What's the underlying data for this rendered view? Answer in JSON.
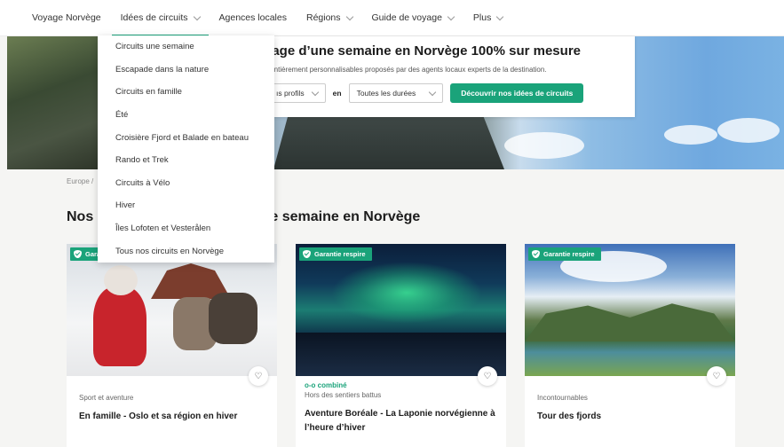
{
  "nav": {
    "items": [
      {
        "label": "Voyage Norvège",
        "has_chevron": false
      },
      {
        "label": "Idées de circuits",
        "has_chevron": true
      },
      {
        "label": "Agences locales",
        "has_chevron": false
      },
      {
        "label": "Régions",
        "has_chevron": true
      },
      {
        "label": "Guide de voyage",
        "has_chevron": true
      },
      {
        "label": "Plus",
        "has_chevron": true
      }
    ]
  },
  "dropdown": {
    "items": [
      "Circuits une semaine",
      "Escapade dans la nature",
      "Circuits en famille",
      "Été",
      "Croisière Fjord et Balade en bateau",
      "Rando et Trek",
      "Circuits à Vélo",
      "Hiver",
      "Îles Lofoten et Vesterålen",
      "Tous nos circuits en Norvège"
    ]
  },
  "hero": {
    "title": "yage d’une semaine en Norvège 100% sur mesure",
    "subtitle": "s entièrement personnalisables proposés par des agents locaux experts de la destination.",
    "profile_select": "ıs profils",
    "en_label": "en",
    "duration_select": "Toutes les durées",
    "cta": "Découvrir nos idées de circuits"
  },
  "breadcrumb": "Europe /",
  "section_title": "Nos                                its d’une semaine en Norvège",
  "cards": [
    {
      "badge": "Garantie respire",
      "category": "Sport et aventure",
      "title": "En famille - Oslo et sa région en hiver"
    },
    {
      "badge": "Garantie respire",
      "combo": "o-o combiné",
      "category": "Hors des sentiers battus",
      "title": "Aventure Boréale - La Laponie norvégienne à l’heure d’hiver"
    },
    {
      "badge": "Garantie respire",
      "category": "Incontournables",
      "title": "Tour des fjords"
    }
  ],
  "colors": {
    "accent": "#1aa37a"
  }
}
